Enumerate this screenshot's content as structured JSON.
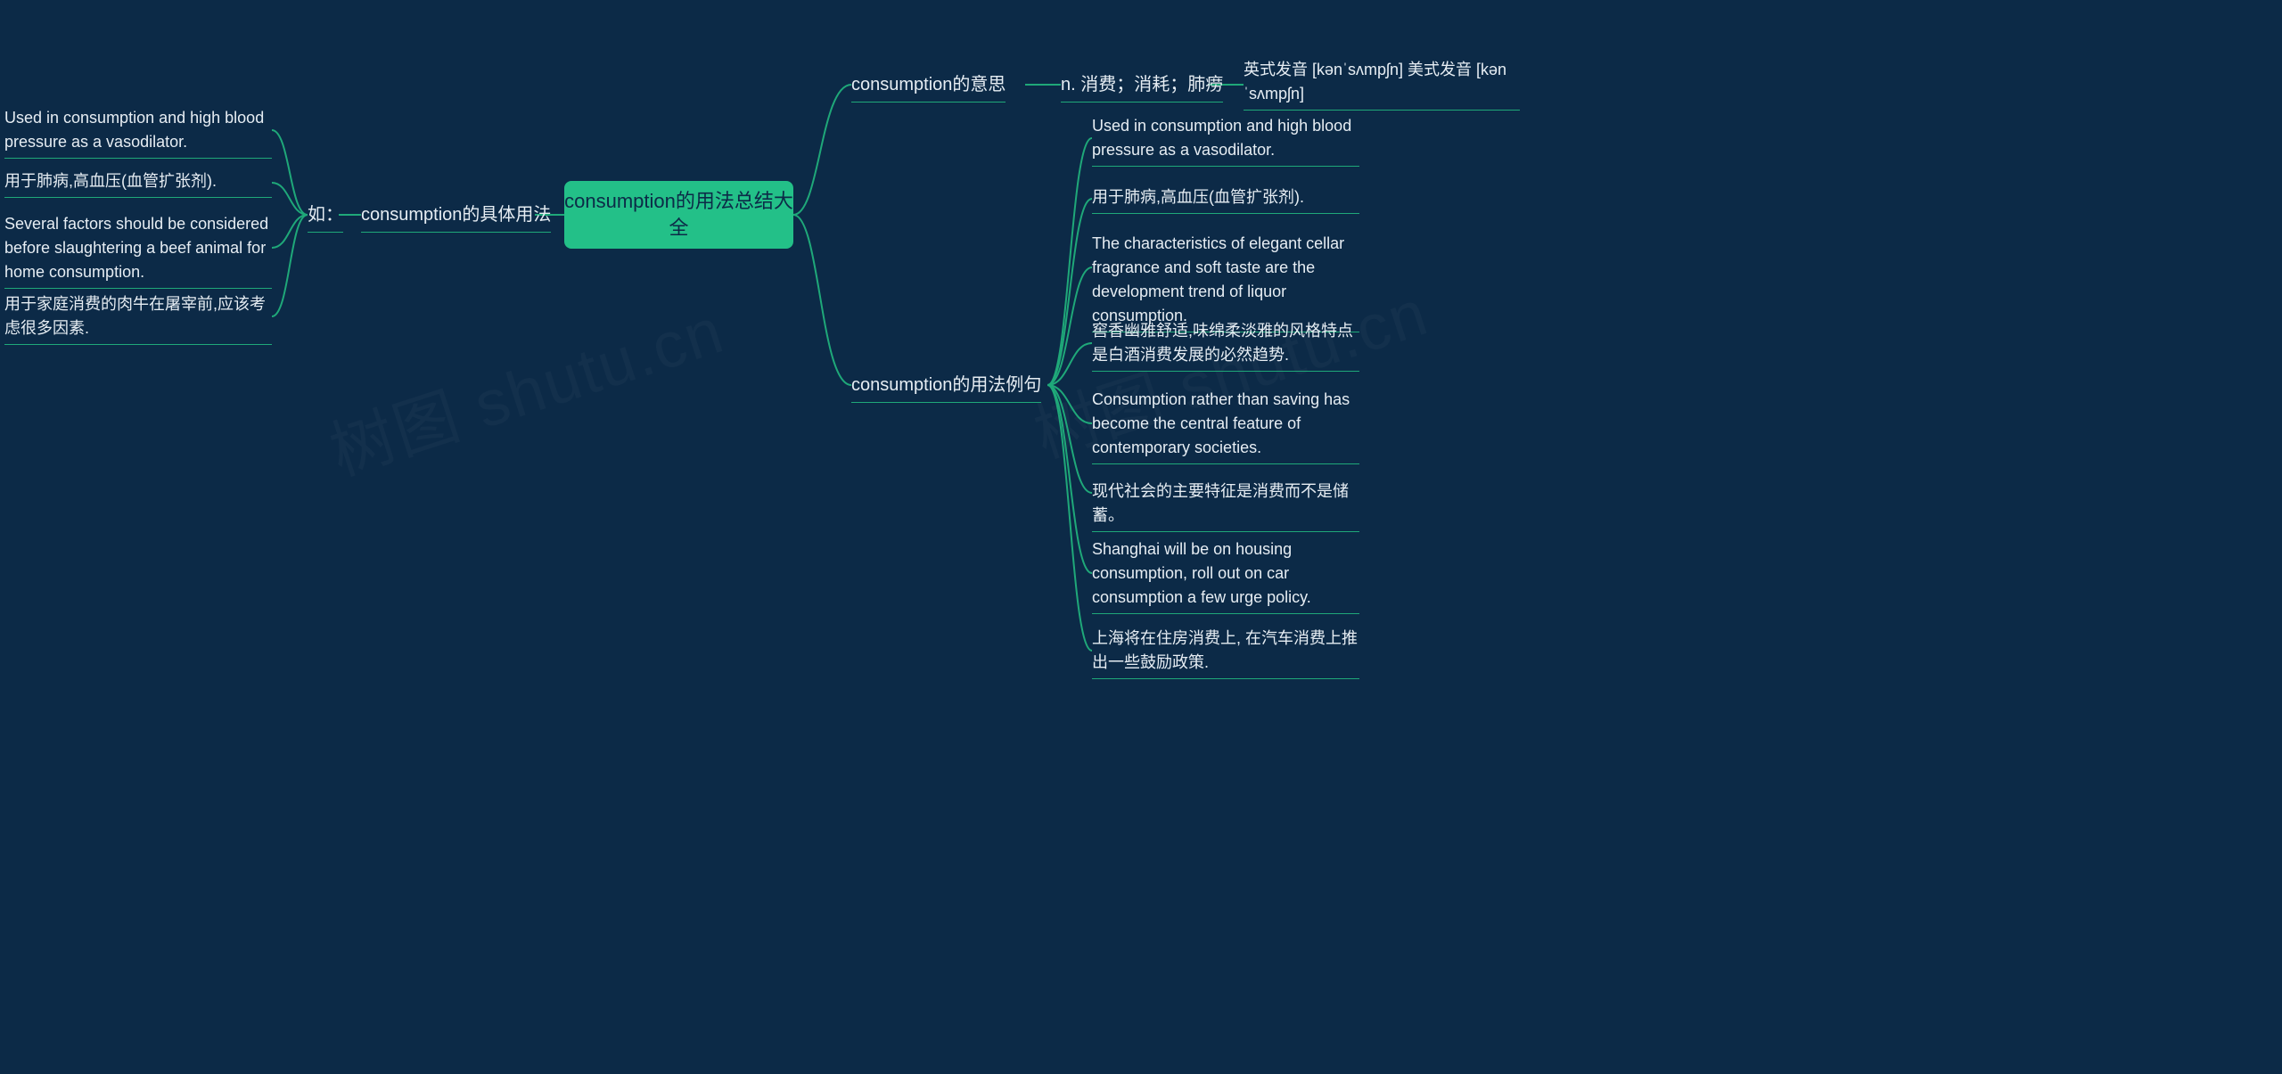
{
  "root": {
    "title": "consumption的用法总结大全"
  },
  "watermark": "树图 shutu.cn",
  "right": {
    "meaning": {
      "label": "consumption的意思",
      "sense": "n. 消费；消耗；肺痨",
      "pronunciation": "英式发音 [kənˈsʌmpʃn] 美式发音 [kənˈsʌmpʃn]"
    },
    "examples": {
      "label": "consumption的用法例句",
      "items": [
        "Used in consumption and high blood pressure as a vasodilator.",
        "用于肺病,高血压(血管扩张剂).",
        "The characteristics of elegant cellar fragrance and soft taste are the development trend of liquor consumption.",
        "窖香幽雅舒适,味绵柔淡雅的风格特点是白酒消费发展的必然趋势.",
        "Consumption rather than saving has become the central feature of contemporary societies.",
        "现代社会的主要特征是消费而不是储蓄。",
        "Shanghai will be on housing consumption, roll out on car consumption a few urge policy.",
        "上海将在住房消费上, 在汽车消费上推出一些鼓励政策."
      ]
    }
  },
  "left": {
    "usage": {
      "label": "consumption的具体用法",
      "prefix": "如：",
      "items": [
        "Used in consumption and high blood pressure as a vasodilator.",
        "用于肺病,高血压(血管扩张剂).",
        "Several factors should be considered before slaughtering a beef animal for home consumption.",
        "用于家庭消费的肉牛在屠宰前,应该考虑很多因素."
      ]
    }
  }
}
